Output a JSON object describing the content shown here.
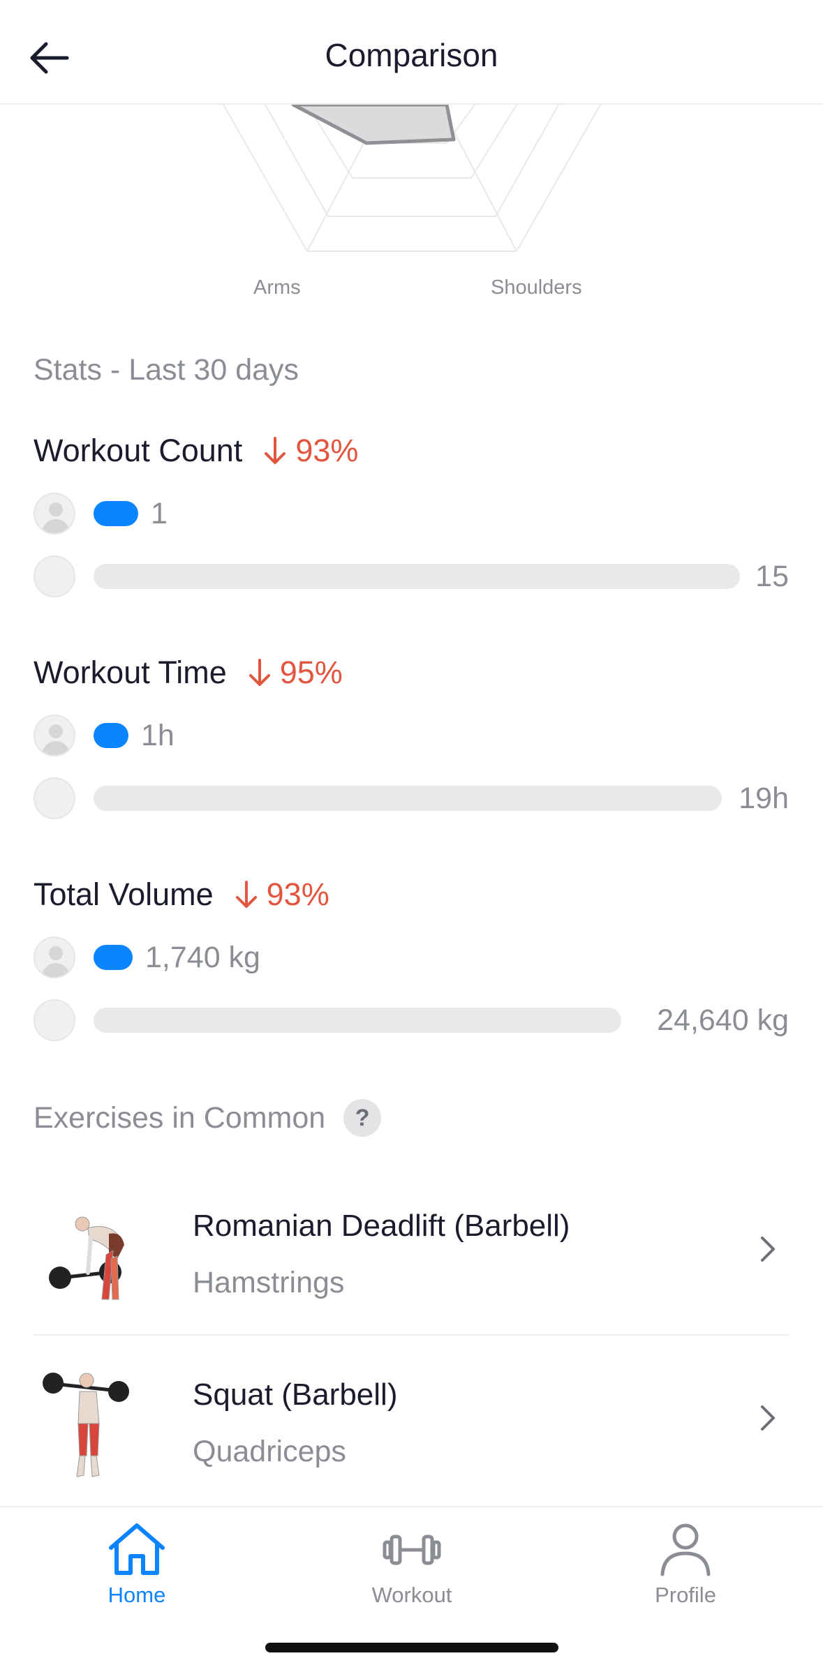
{
  "header": {
    "title": "Comparison"
  },
  "radar": {
    "labels": [
      "Arms",
      "Shoulders"
    ]
  },
  "stats": {
    "section_title": "Stats - Last 30 days",
    "metrics": [
      {
        "title": "Workout Count",
        "change": "93%",
        "direction": "down",
        "mine": "1",
        "theirs": "15",
        "mine_fraction": 0.067,
        "theirs_fraction": 1.0
      },
      {
        "title": "Workout Time",
        "change": "95%",
        "direction": "down",
        "mine": "1h",
        "theirs": "19h",
        "mine_fraction": 0.053,
        "theirs_fraction": 1.0
      },
      {
        "title": "Total Volume",
        "change": "93%",
        "direction": "down",
        "mine": "1,740 kg",
        "theirs": "24,640 kg",
        "mine_fraction": 0.071,
        "theirs_fraction": 1.0
      }
    ]
  },
  "exercises": {
    "section_title": "Exercises in Common",
    "help_label": "?",
    "items": [
      {
        "name": "Romanian Deadlift (Barbell)",
        "muscle": "Hamstrings"
      },
      {
        "name": "Squat (Barbell)",
        "muscle": "Quadriceps"
      }
    ]
  },
  "tabbar": {
    "items": [
      {
        "label": "Home",
        "icon": "home-icon",
        "active": true
      },
      {
        "label": "Workout",
        "icon": "dumbbell-icon",
        "active": false
      },
      {
        "label": "Profile",
        "icon": "person-icon",
        "active": false
      }
    ]
  },
  "colors": {
    "accent": "#0a84ff",
    "decrease": "#e2553f",
    "muted": "#8a8d93",
    "text": "#1a1c2e"
  }
}
